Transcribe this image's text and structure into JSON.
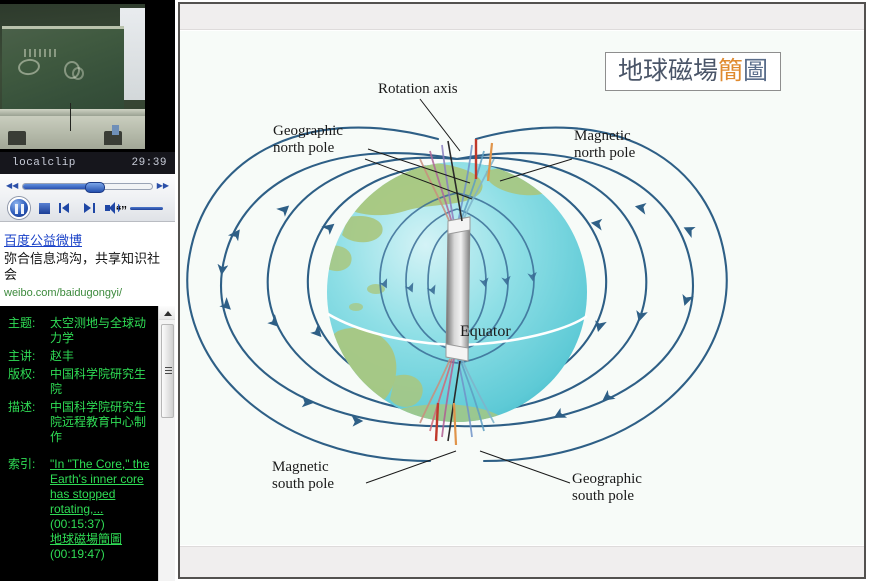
{
  "sidebar": {
    "player": {
      "clip_name": "localclip",
      "time": "29:39",
      "rewind_icon": "rewind-icon",
      "forward_icon": "fast-forward-icon",
      "pause_icon": "pause-icon",
      "stop_icon": "stop-icon",
      "prev_icon": "previous-track-icon",
      "next_icon": "next-track-icon",
      "volume_icon": "volume-icon"
    },
    "ad": {
      "link": "百度公益微博",
      "text": "弥合信息鸿沟，共享知识社会",
      "url": "weibo.com/baidugongyi/"
    },
    "meta": [
      {
        "key": "主题:",
        "value": "太空测地与全球动力学"
      },
      {
        "key": "主讲:",
        "value": "赵丰"
      },
      {
        "key": "版权:",
        "value": "中国科学院研究生院"
      },
      {
        "key": "描述:",
        "value": "中国科学院研究生院远程教育中心制作"
      }
    ],
    "index": {
      "key": "索引:",
      "items": [
        {
          "label": "\"In \"The Core,\" the Earth's inner core has stopped rotating,...",
          "time": "(00:15:37)"
        },
        {
          "label": "地球磁場簡圖",
          "time": "(00:19:47)"
        }
      ]
    },
    "scrollbar": {
      "up_icon": "scroll-up-arrow-icon",
      "thumb_icon": "scrollbar-thumb"
    }
  },
  "main": {
    "slide": {
      "title_parts": [
        {
          "text": "地球磁場",
          "color": "#4a5568"
        },
        {
          "text": "簡",
          "color": "#e08a2e"
        },
        {
          "text": "圖",
          "color": "#5a6d8a"
        }
      ],
      "title_full": "地球磁場簡圖",
      "labels": {
        "rotation_axis": "Rotation axis",
        "geographic_north_pole": "Geographic\nnorth pole",
        "magnetic_north_pole": "Magnetic\nnorth pole",
        "magnetic_south_pole": "Magnetic\nsouth pole",
        "geographic_south_pole": "Geographic\nsouth pole",
        "equator": "Equator"
      },
      "colors": {
        "field_line": "#2e5f86",
        "globe_ocean": "#7fd9e2",
        "globe_land": "#a9c77e",
        "magnet_bar": "#9a9a9a",
        "rotation_axis_line": "#2a2a2a",
        "magnetic_axis_line": "#c0392b",
        "background": "#f7fbf8"
      }
    }
  }
}
